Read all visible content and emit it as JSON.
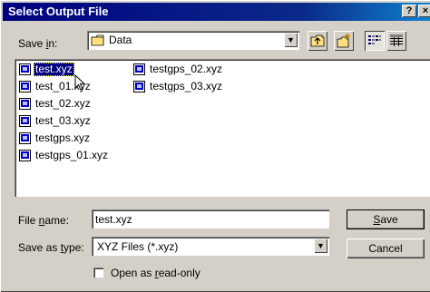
{
  "window": {
    "title": "Select Output File",
    "help_glyph": "?",
    "close_glyph": "×"
  },
  "save_in": {
    "label_pre": "Save ",
    "label_accel": "i",
    "label_post": "n:",
    "folder_icon": "folder-icon",
    "value": "Data"
  },
  "toolbar": {
    "up_icon": "up-one-level-icon",
    "new_folder_icon": "new-folder-icon",
    "list_icon": "list-view-icon",
    "details_icon": "details-view-icon"
  },
  "files": [
    {
      "name": "test.xyz",
      "selected": true
    },
    {
      "name": "test_01.xyz"
    },
    {
      "name": "test_02.xyz"
    },
    {
      "name": "test_03.xyz"
    },
    {
      "name": "testgps.xyz"
    },
    {
      "name": "testgps_01.xyz"
    },
    {
      "name": "testgps_02.xyz"
    },
    {
      "name": "testgps_03.xyz"
    }
  ],
  "file_name": {
    "label_pre": "File ",
    "label_accel": "n",
    "label_post": "ame:",
    "value": "test.xyz"
  },
  "save_type": {
    "label_pre": "Save as ",
    "label_accel": "t",
    "label_post": "ype:",
    "value": "XYZ Files (*.xyz)"
  },
  "buttons": {
    "save_accel": "S",
    "save_rest": "ave",
    "cancel": "Cancel"
  },
  "readonly": {
    "label_pre": "Open as ",
    "label_accel": "r",
    "label_post": "ead-only",
    "checked": false
  },
  "colors": {
    "title_bar": "#000080",
    "selection": "#000080",
    "face": "#d4d0c8"
  }
}
